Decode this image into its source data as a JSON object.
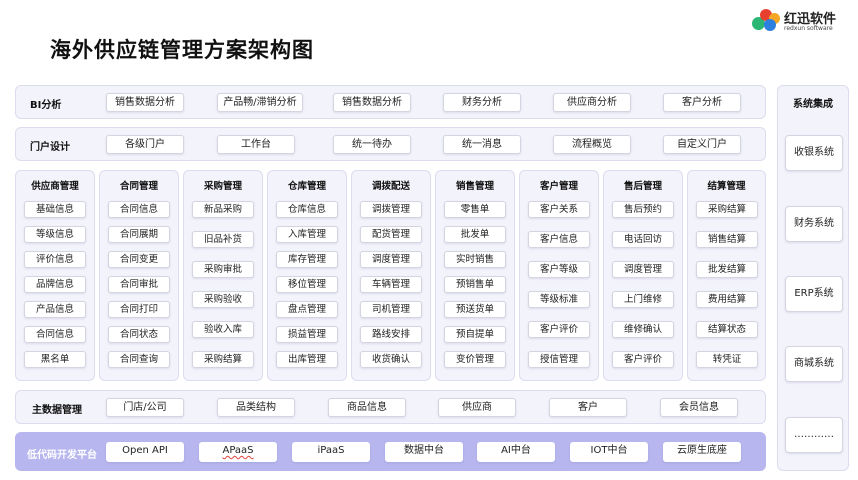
{
  "title": "海外供应链管理方案架构图",
  "logo": {
    "name": "红迅软件",
    "sub": "redxun software"
  },
  "bi": {
    "label": "BI分析",
    "items": [
      "销售数据分析",
      "产品畅/滞销分析",
      "销售数据分析",
      "财务分析",
      "供应商分析",
      "客户分析"
    ]
  },
  "portal": {
    "label": "门户设计",
    "items": [
      "各级门户",
      "工作台",
      "统一待办",
      "统一消息",
      "流程概览",
      "自定义门户"
    ]
  },
  "columns": [
    {
      "title": "供应商管理",
      "items": [
        "基础信息",
        "等级信息",
        "评价信息",
        "品牌信息",
        "产品信息",
        "合同信息",
        "黑名单"
      ]
    },
    {
      "title": "合同管理",
      "items": [
        "合同信息",
        "合同展期",
        "合同变更",
        "合同审批",
        "合同打印",
        "合同状态",
        "合同查询"
      ]
    },
    {
      "title": "采购管理",
      "items": [
        "新品采购",
        "旧品补货",
        "采购审批",
        "采购验收",
        "验收入库",
        "采购结算"
      ]
    },
    {
      "title": "仓库管理",
      "items": [
        "仓库信息",
        "入库管理",
        "库存管理",
        "移位管理",
        "盘点管理",
        "损益管理",
        "出库管理"
      ]
    },
    {
      "title": "调拨配送",
      "items": [
        "调拨管理",
        "配货管理",
        "调度管理",
        "车辆管理",
        "司机管理",
        "路线安排",
        "收货确认"
      ]
    },
    {
      "title": "销售管理",
      "items": [
        "零售单",
        "批发单",
        "实时销售",
        "预销售单",
        "预送货单",
        "预自提单",
        "变价管理"
      ]
    },
    {
      "title": "客户管理",
      "items": [
        "客户关系",
        "客户信息",
        "客户等级",
        "等级标准",
        "客户评价",
        "授信管理"
      ]
    },
    {
      "title": "售后管理",
      "items": [
        "售后预约",
        "电话回访",
        "调度管理",
        "上门维修",
        "维修确认",
        "客户评价"
      ]
    },
    {
      "title": "结算管理",
      "items": [
        "采购结算",
        "销售结算",
        "批发结算",
        "费用结算",
        "结算状态",
        "转凭证"
      ]
    }
  ],
  "master": {
    "label": "主数据管理",
    "items": [
      "门店/公司",
      "品类结构",
      "商品信息",
      "供应商",
      "客户",
      "会员信息"
    ]
  },
  "lowcode": {
    "label": "低代码开发平台",
    "items": [
      "Open API",
      "APaaS",
      "iPaaS",
      "数据中台",
      "AI中台",
      "IOT中台",
      "云原生底座"
    ]
  },
  "integration": {
    "label": "系统集成",
    "items": [
      "收银系统",
      "财务系统",
      "ERP系统",
      "商城系统",
      "…………"
    ]
  },
  "colors": {
    "panel": "#f3f3fb",
    "lowcode": "#b7b6ee",
    "logo_red": "#e8402f",
    "logo_orange": "#f5a623",
    "logo_green": "#2bb673",
    "logo_blue": "#2d7fe0"
  }
}
